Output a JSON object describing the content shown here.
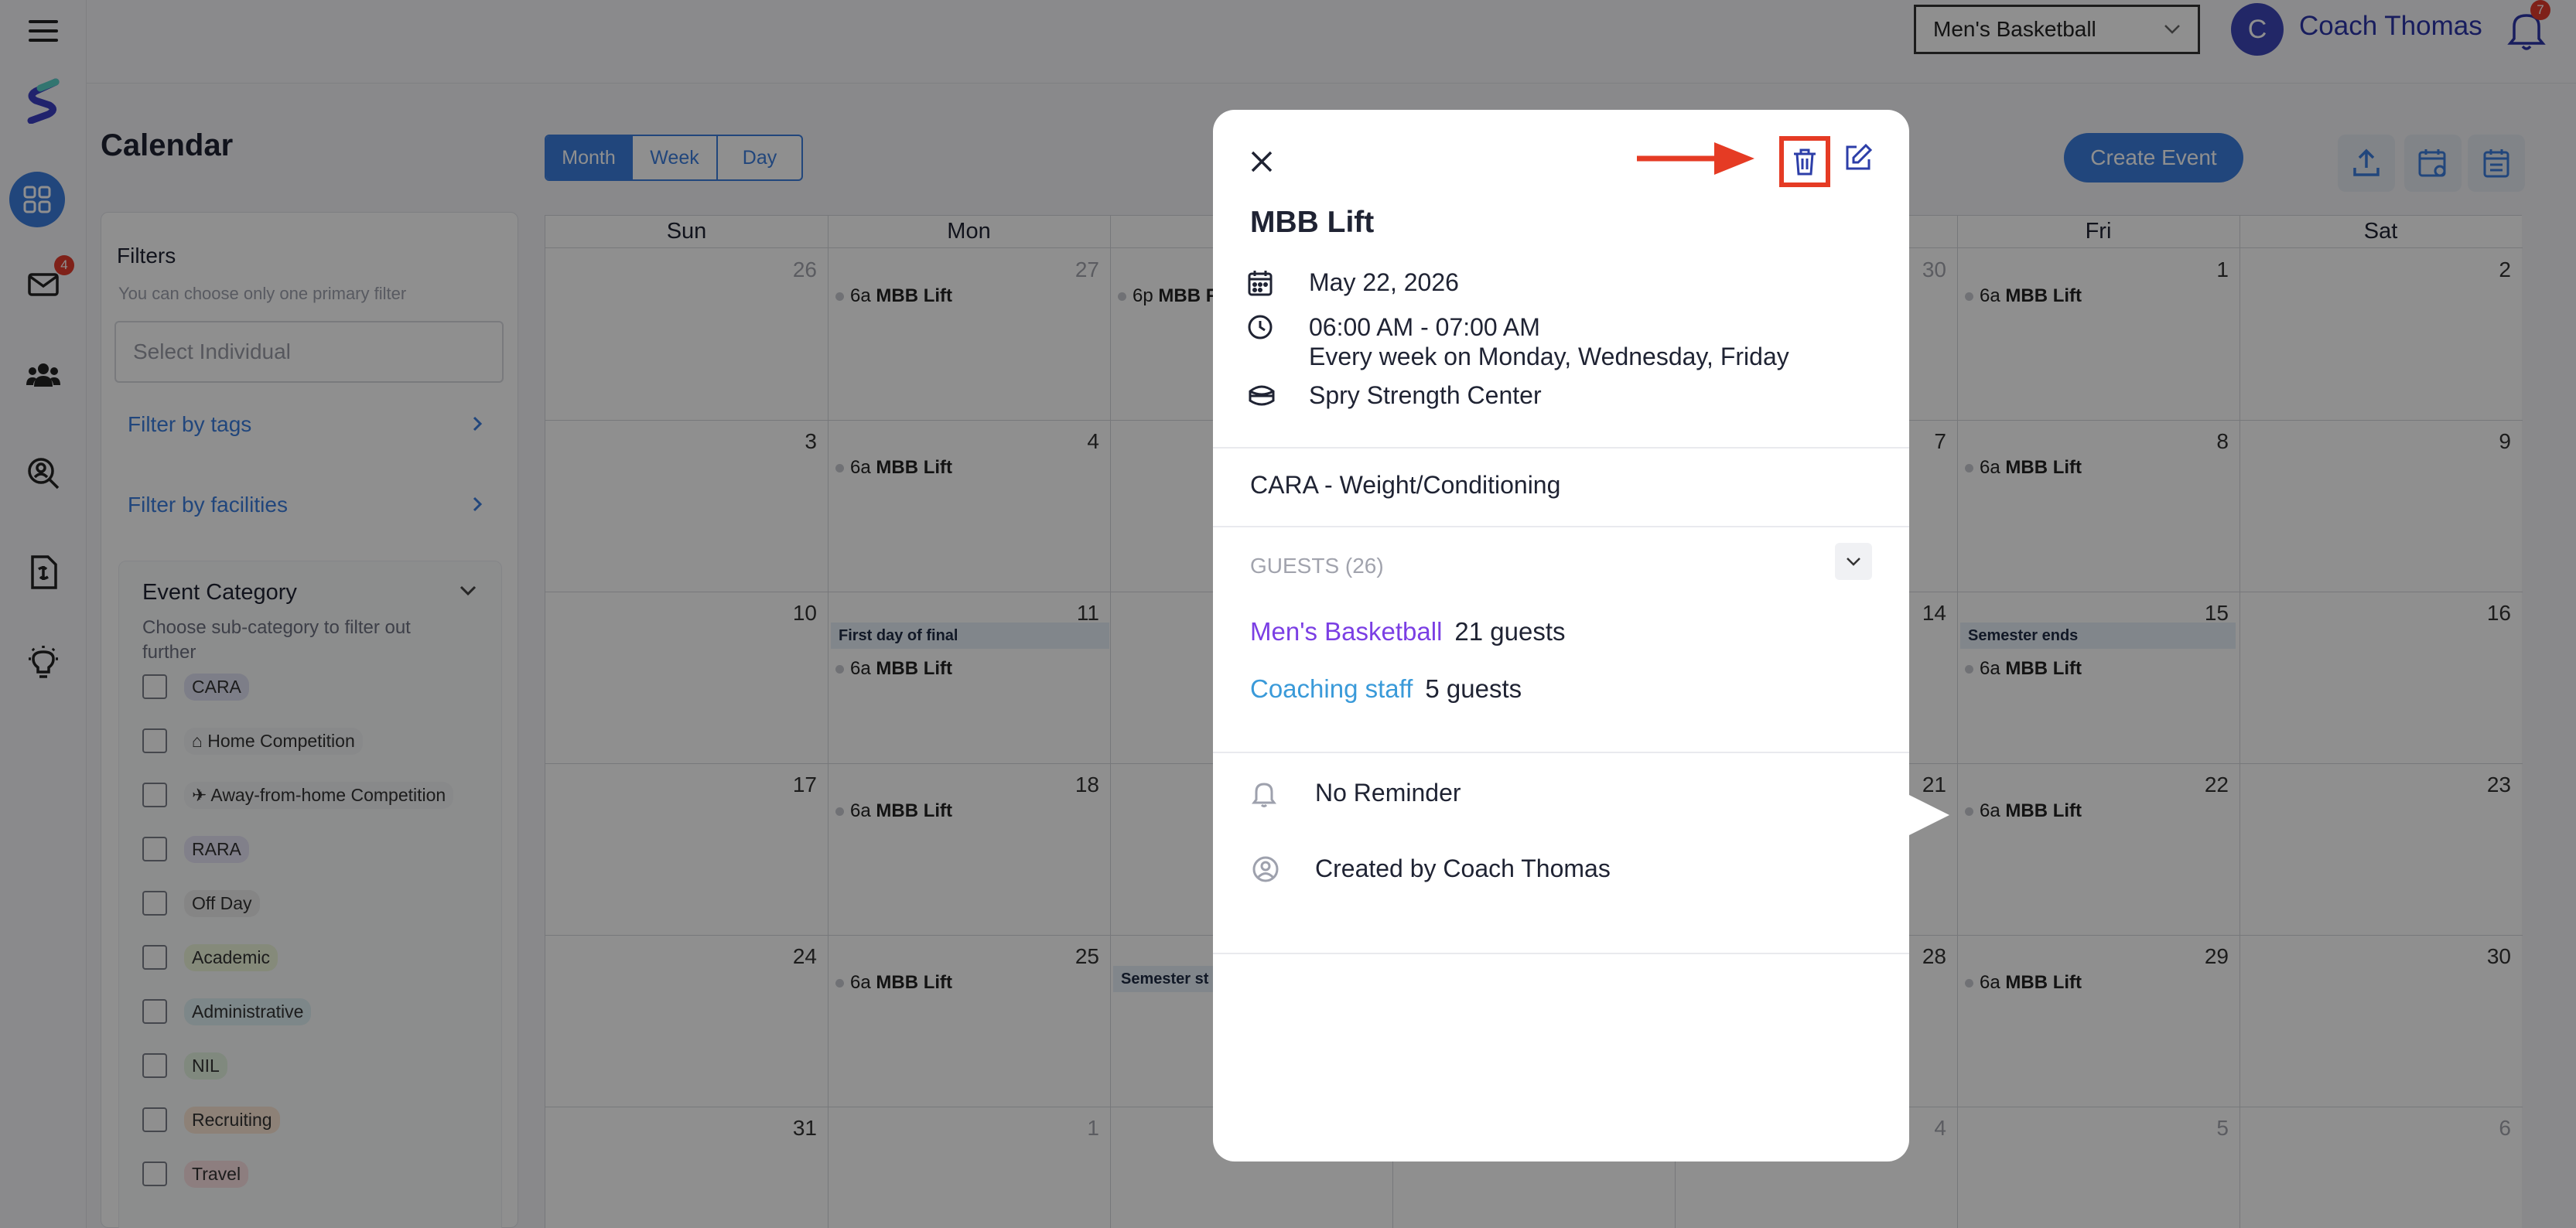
{
  "topbar": {
    "team_select": "Men's Basketball",
    "avatar_letter": "C",
    "user_name": "Coach Thomas",
    "notification_count": "7"
  },
  "sidebar": {
    "messages_badge": "4"
  },
  "page": {
    "title": "Calendar"
  },
  "filters": {
    "title": "Filters",
    "hint": "You can choose only one primary filter",
    "individual_placeholder": "Select Individual",
    "by_tags": "Filter by tags",
    "by_facilities": "Filter by facilities",
    "category": {
      "title": "Event Category",
      "hint": "Choose sub-category to filter out further",
      "items": [
        {
          "label": "CARA",
          "color": "#dfe1f3"
        },
        {
          "label": "⌂ Home Competition",
          "color": "#f3f4f6"
        },
        {
          "label": "✈ Away-from-home Competition",
          "color": "#f3f4f6"
        },
        {
          "label": "RARA",
          "color": "#e7e4f7"
        },
        {
          "label": "Off Day",
          "color": "#eeeeee"
        },
        {
          "label": "Academic",
          "color": "#eef6d9"
        },
        {
          "label": "Administrative",
          "color": "#dff1f4"
        },
        {
          "label": "NIL",
          "color": "#e5f5e1"
        },
        {
          "label": "Recruiting",
          "color": "#fbe6d4"
        },
        {
          "label": "Travel",
          "color": "#fbe0e3"
        }
      ]
    }
  },
  "toolbar": {
    "views": [
      "Month",
      "Week",
      "Day"
    ],
    "create_event": "Create Event"
  },
  "calendar": {
    "days_of_week": [
      "Sun",
      "Mon",
      "Tue",
      "Wed",
      "Thu",
      "Fri",
      "Sat"
    ],
    "weeks": [
      [
        "26",
        "27",
        "",
        "",
        "30",
        "1",
        "2"
      ],
      [
        "3",
        "4",
        "",
        "",
        "7",
        "8",
        "9"
      ],
      [
        "10",
        "11",
        "",
        "",
        "14",
        "15",
        "16"
      ],
      [
        "17",
        "18",
        "",
        "",
        "21",
        "22",
        "23"
      ],
      [
        "24",
        "25",
        "",
        "",
        "28",
        "29",
        "30"
      ],
      [
        "31",
        "1",
        "",
        "",
        "4",
        "5",
        "6"
      ]
    ],
    "event_time": "6a",
    "event_time_tue": "6p",
    "event_name": "MBB Lift",
    "event_name_cut": "MBB F",
    "banner_first_day": "First day of final",
    "banner_semester_ends": "Semester ends",
    "banner_semester_starts_cut": "Semester st"
  },
  "modal": {
    "title": "MBB Lift",
    "date": "May 22, 2026",
    "time": "06:00 AM - 07:00 AM",
    "recurrence": "Every week on Monday, Wednesday, Friday",
    "location": "Spry Strength Center",
    "category": "CARA - Weight/Conditioning",
    "guests_title": "GUESTS (26)",
    "guest_groups": [
      {
        "name": "Men's Basketball",
        "count": "21 guests",
        "color": "#7b3fe4"
      },
      {
        "name": "Coaching staff",
        "count": "5 guests",
        "color": "#3a9ad9"
      }
    ],
    "reminder": "No Reminder",
    "created_by": "Created by Coach Thomas"
  }
}
